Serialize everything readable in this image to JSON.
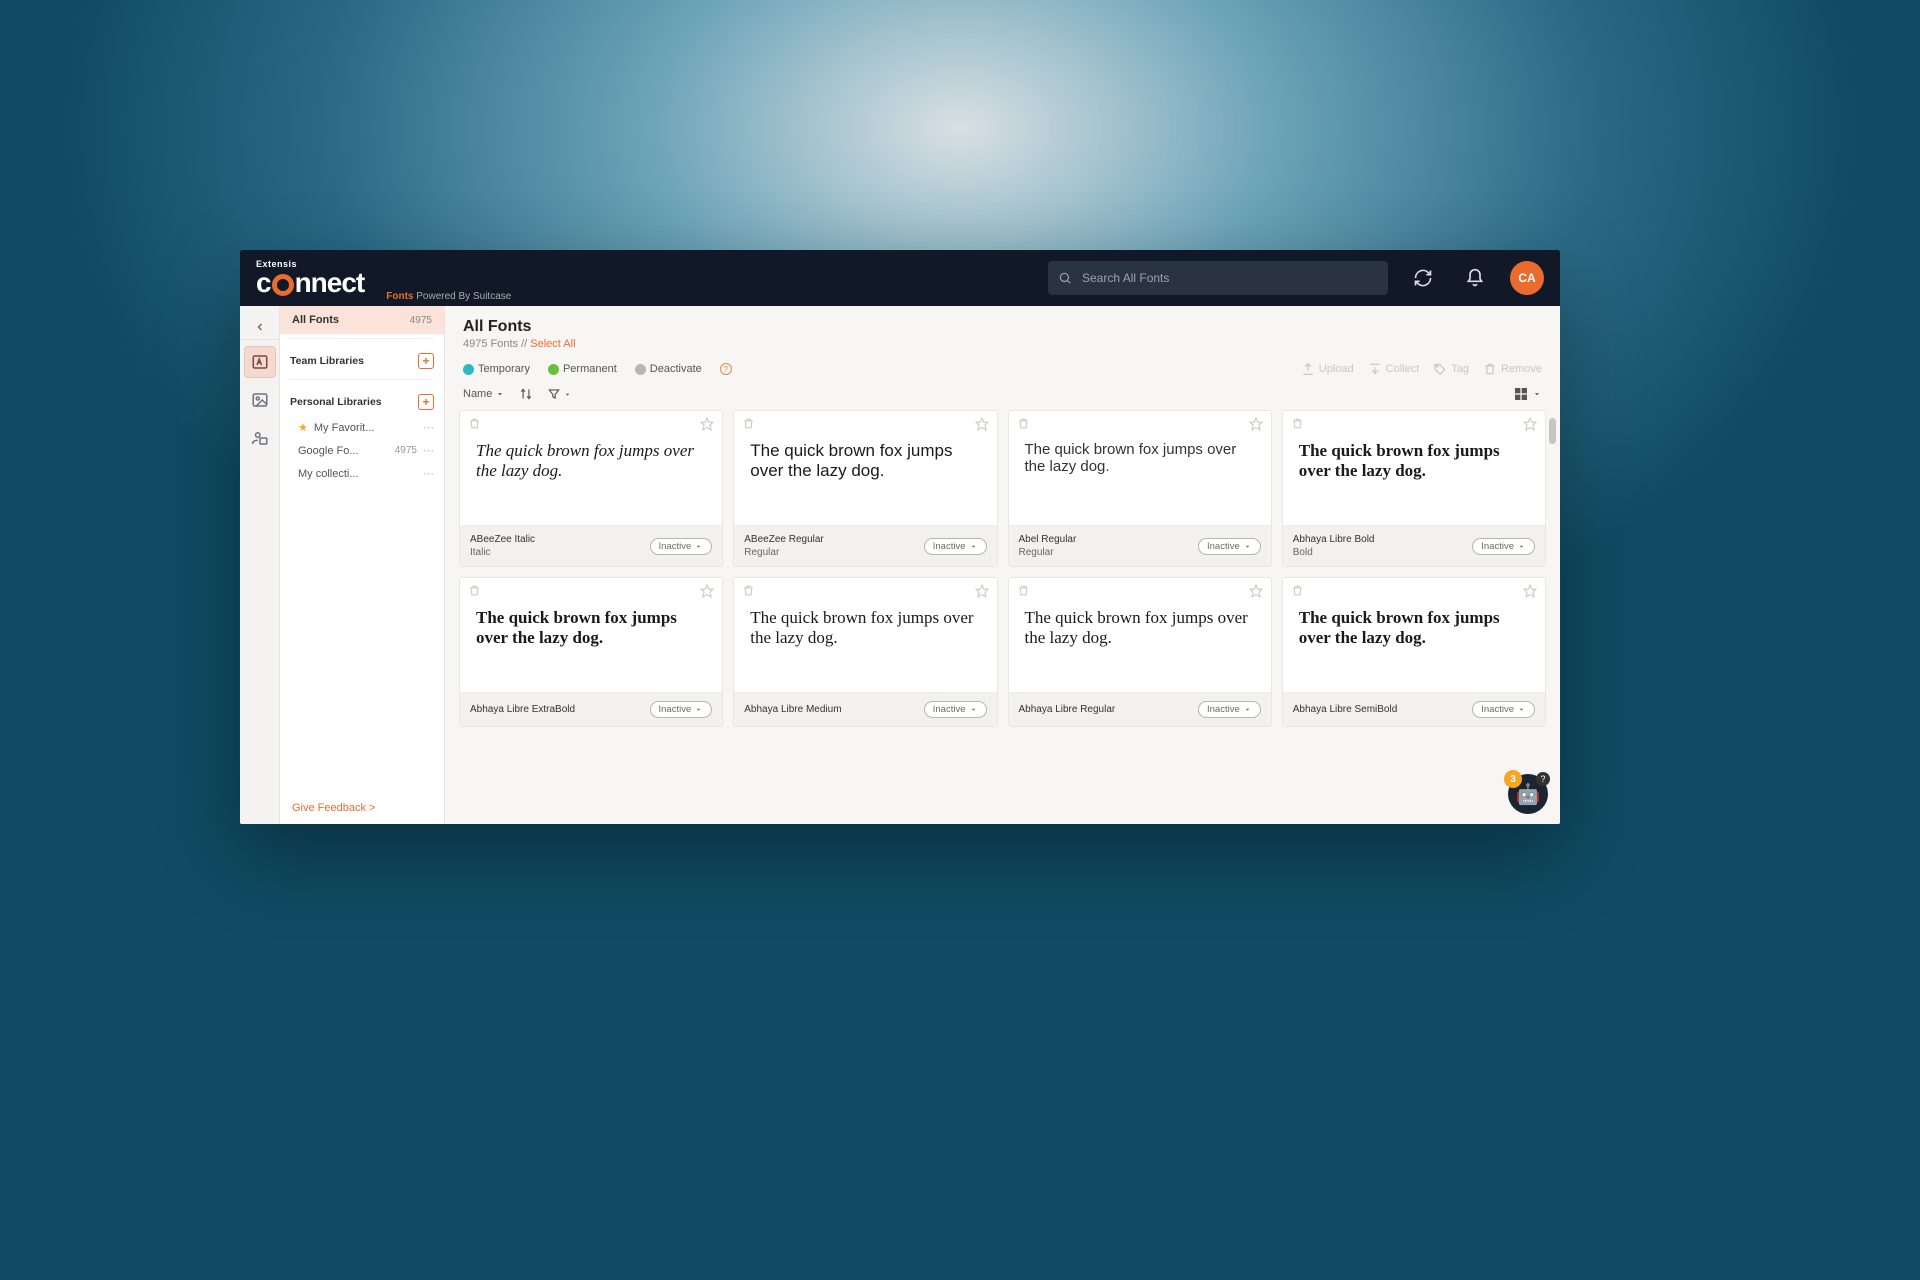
{
  "header": {
    "brand_small": "Extensis",
    "brand_left": "c",
    "brand_right": "nnect",
    "tag_bold": "Fonts",
    "tag_rest": " Powered By Suitcase",
    "search_placeholder": "Search All Fonts",
    "avatar_initials": "CA"
  },
  "sidebar": {
    "all_fonts_label": "All Fonts",
    "all_fonts_count": "4975",
    "team_header": "Team Libraries",
    "personal_header": "Personal Libraries",
    "personal": {
      "fav_label": "My Favorit...",
      "google_label": "Google Fo...",
      "google_count": "4975",
      "coll_label": "My collecti..."
    },
    "feedback": "Give Feedback >"
  },
  "main": {
    "title": "All Fonts",
    "sub_count": "4975 Fonts",
    "sub_sep": " // ",
    "select_all": "Select All",
    "status": {
      "temporary": "Temporary",
      "permanent": "Permanent",
      "deactivate": "Deactivate"
    },
    "actions": {
      "upload": "Upload",
      "collect": "Collect",
      "tag": "Tag",
      "remove": "Remove"
    },
    "sort_label": "Name",
    "pangram": "The quick brown fox jumps over the lazy dog.",
    "inactive": "Inactive",
    "cards": [
      {
        "name": "ABeeZee Italic",
        "style": "Italic",
        "cls": "italic"
      },
      {
        "name": "ABeeZee Regular",
        "style": "Regular",
        "cls": "sans"
      },
      {
        "name": "Abel Regular",
        "style": "Regular",
        "cls": "cond"
      },
      {
        "name": "Abhaya Libre Bold",
        "style": "Bold",
        "cls": "serifb"
      },
      {
        "name": "Abhaya Libre ExtraBold",
        "style": "",
        "cls": "serifxb"
      },
      {
        "name": "Abhaya Libre Medium",
        "style": "",
        "cls": "serifm"
      },
      {
        "name": "Abhaya Libre Regular",
        "style": "",
        "cls": "serifr"
      },
      {
        "name": "Abhaya Libre SemiBold",
        "style": "",
        "cls": "serifsb"
      }
    ],
    "help_badge": "3"
  }
}
